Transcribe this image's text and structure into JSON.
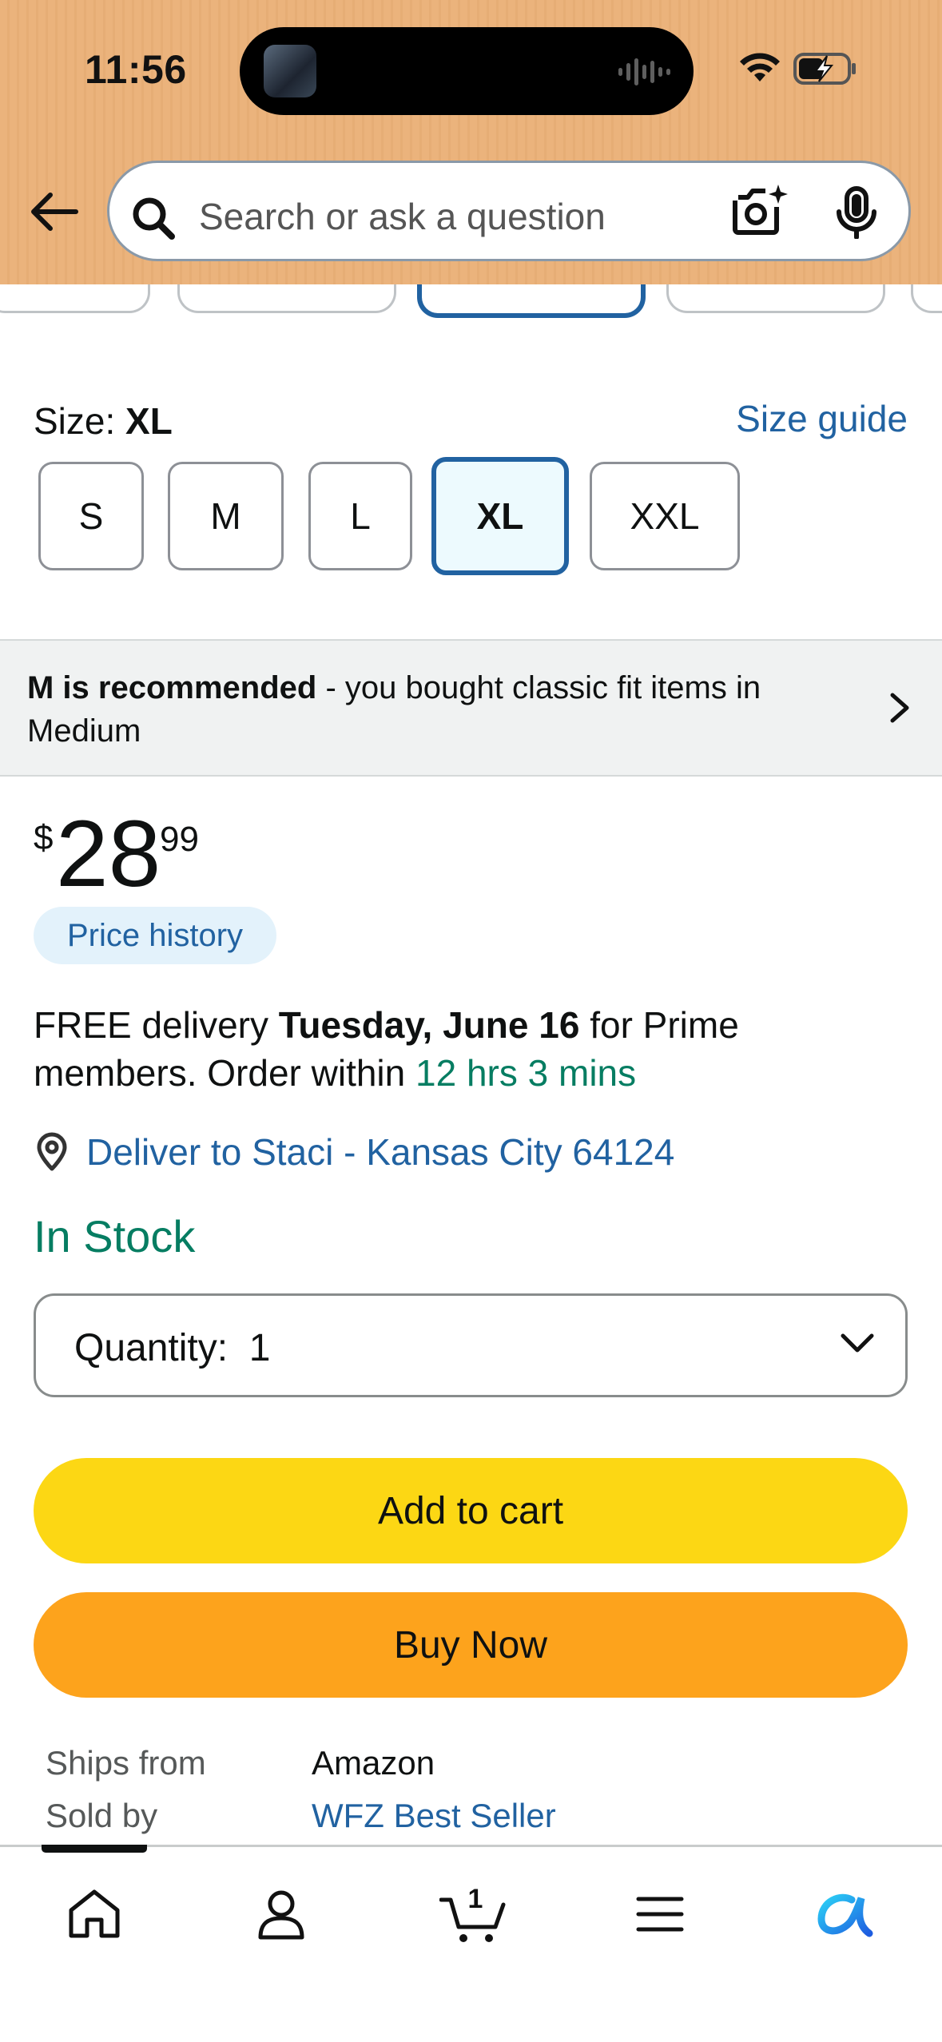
{
  "status_bar": {
    "time": "11:56",
    "icons": [
      "wifi-icon",
      "battery-charging-icon"
    ]
  },
  "header": {
    "back_icon": "arrow-left-icon",
    "search_placeholder": "Search or ask a question",
    "camera_icon": "camera-search-icon",
    "mic_icon": "microphone-icon",
    "background_color": "#ebb37c"
  },
  "size_selector": {
    "label": "Size: ",
    "selected": "XL",
    "guide_link": "Size guide",
    "options": [
      "S",
      "M",
      "L",
      "XL",
      "XXL"
    ]
  },
  "recommendation": {
    "bold": "M is recommended",
    "text": " - you bought classic fit items in Medium"
  },
  "price": {
    "currency": "$",
    "whole": "28",
    "fraction": "99",
    "history_label": "Price history"
  },
  "delivery": {
    "prefix": "FREE delivery ",
    "date": "Tuesday, June 16",
    "middle": " for Prime members. Order within ",
    "countdown": "12 hrs 3 mins",
    "deliver_to": "Deliver to Staci - Kansas City 64124"
  },
  "stock": "In Stock",
  "quantity": {
    "label": "Quantity:",
    "value": "1"
  },
  "buttons": {
    "add_to_cart": "Add to cart",
    "buy_now": "Buy Now"
  },
  "seller_info": {
    "ships_from_label": "Ships from",
    "ships_from_value": "Amazon",
    "sold_by_label": "Sold by",
    "sold_by_value": "WFZ Best Seller"
  },
  "bottom_nav": {
    "cart_count": "1",
    "items": [
      "home-icon",
      "account-icon",
      "cart-icon",
      "menu-icon",
      "rufus-icon"
    ]
  },
  "colors": {
    "link": "#2162a1",
    "green": "#067d62",
    "add_to_cart": "#fcd714",
    "buy_now": "#fda31c"
  }
}
